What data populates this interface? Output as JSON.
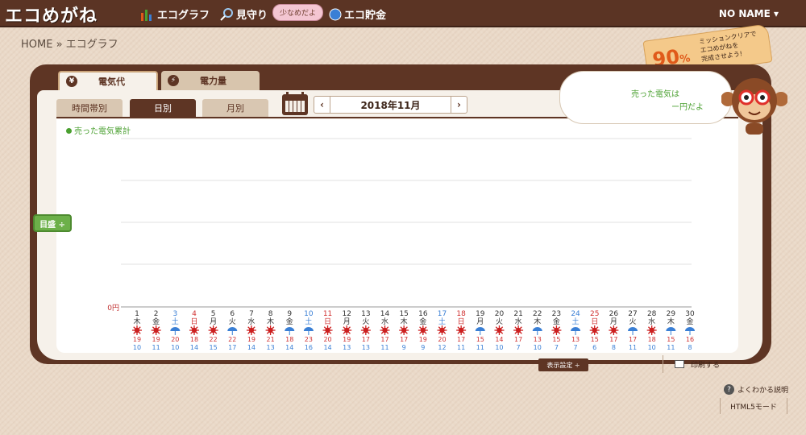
{
  "header": {
    "logo": "エコめがね",
    "nav": [
      {
        "label": "エコグラフ",
        "icon": "bar-chart-icon"
      },
      {
        "label": "見守り",
        "icon": "magnifier-icon"
      },
      {
        "label": "エコ貯金",
        "icon": "coin-icon"
      }
    ],
    "speech": "少なめだよ",
    "user": "NO NAME"
  },
  "breadcrumb": "HOME » エコグラフ",
  "tabs": {
    "main": [
      "電気代",
      "電力量"
    ],
    "sub": [
      "時間帯別",
      "日別",
      "月別"
    ]
  },
  "date_nav": {
    "label": "2018年11月",
    "prev": "‹",
    "next": "›"
  },
  "legend": "売った電気累計",
  "target_button": "目盛 ÷",
  "sold": {
    "title": "売った電気は",
    "value": "ー円だよ"
  },
  "mission": {
    "percent": "90",
    "unit": "%",
    "line1": "ミッションクリアで",
    "line2": "エコめがねを",
    "line3": "完成させよう!"
  },
  "footer": {
    "display_settings": "表示設定 ÷",
    "print": "印刷する",
    "help": "よくわかる説明",
    "html5": "HTML5モード"
  },
  "colors": {
    "brown": "#5e3524",
    "green": "#4aa030",
    "red": "#d03030",
    "blue": "#3a7fd5",
    "sun": "#cc2020",
    "rain": "#3a7fd5"
  },
  "chart_data": {
    "type": "bar",
    "title": "",
    "ylabel": "",
    "y_tick_label": "0円",
    "grid": true,
    "days": [
      "1",
      "2",
      "3",
      "4",
      "5",
      "6",
      "7",
      "8",
      "9",
      "10",
      "11",
      "12",
      "13",
      "14",
      "15",
      "16",
      "17",
      "18",
      "19",
      "20",
      "21",
      "22",
      "23",
      "24",
      "25",
      "26",
      "27",
      "28",
      "29",
      "30"
    ],
    "weekdays": [
      "木",
      "金",
      "土",
      "日",
      "月",
      "火",
      "水",
      "木",
      "金",
      "土",
      "日",
      "月",
      "火",
      "水",
      "木",
      "金",
      "土",
      "日",
      "月",
      "火",
      "水",
      "木",
      "金",
      "土",
      "日",
      "月",
      "火",
      "水",
      "木",
      "金"
    ],
    "weather": [
      "sun",
      "sun",
      "rain",
      "sun",
      "sun",
      "rain",
      "sun",
      "sun",
      "rain",
      "rain",
      "sun",
      "sun",
      "sun",
      "sun",
      "sun",
      "sun",
      "sun",
      "sun",
      "rain",
      "sun",
      "sun",
      "rain",
      "sun",
      "rain",
      "sun",
      "sun",
      "rain",
      "sun",
      "rain",
      "rain"
    ],
    "high": [
      "19",
      "19",
      "20",
      "18",
      "22",
      "22",
      "19",
      "21",
      "18",
      "23",
      "20",
      "19",
      "17",
      "17",
      "17",
      "19",
      "20",
      "17",
      "15",
      "14",
      "17",
      "13",
      "15",
      "13",
      "15",
      "17",
      "17",
      "18",
      "15",
      "16"
    ],
    "low": [
      "10",
      "11",
      "10",
      "14",
      "15",
      "17",
      "14",
      "13",
      "14",
      "16",
      "14",
      "13",
      "13",
      "11",
      "9",
      "9",
      "12",
      "11",
      "11",
      "10",
      "7",
      "10",
      "7",
      "7",
      "6",
      "8",
      "11",
      "10",
      "11",
      "8"
    ],
    "values": []
  }
}
